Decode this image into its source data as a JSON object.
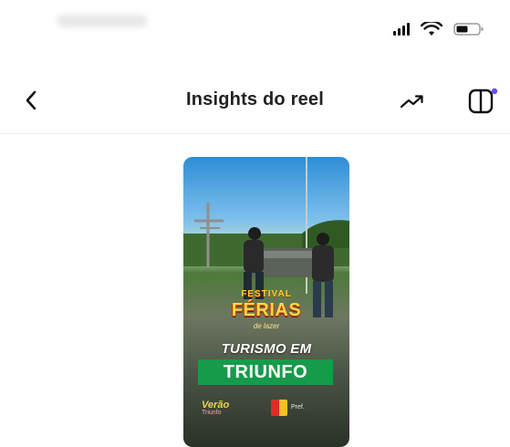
{
  "status_bar": {
    "icons": [
      "signal-icon",
      "wifi-icon",
      "battery-icon"
    ]
  },
  "header": {
    "title": "Insights do reel",
    "back_icon": "chevron-left-icon",
    "trend_icon": "trending-up-icon",
    "panel_icon": "panel-toggle-icon"
  },
  "reel": {
    "festival_top": "FESTIVAL",
    "festival_main": "FÉRIAS",
    "festival_sub": "de lazer",
    "title_line": "TURISMO EM",
    "banner": "TRIUNFO",
    "logo_left": "Verão",
    "logo_left_sub": "Triunfo",
    "logo_right_mini": "Pref."
  },
  "colors": {
    "accent_dot": "#6b4cff",
    "banner_green": "#169b4a",
    "title_text": "#222222"
  }
}
